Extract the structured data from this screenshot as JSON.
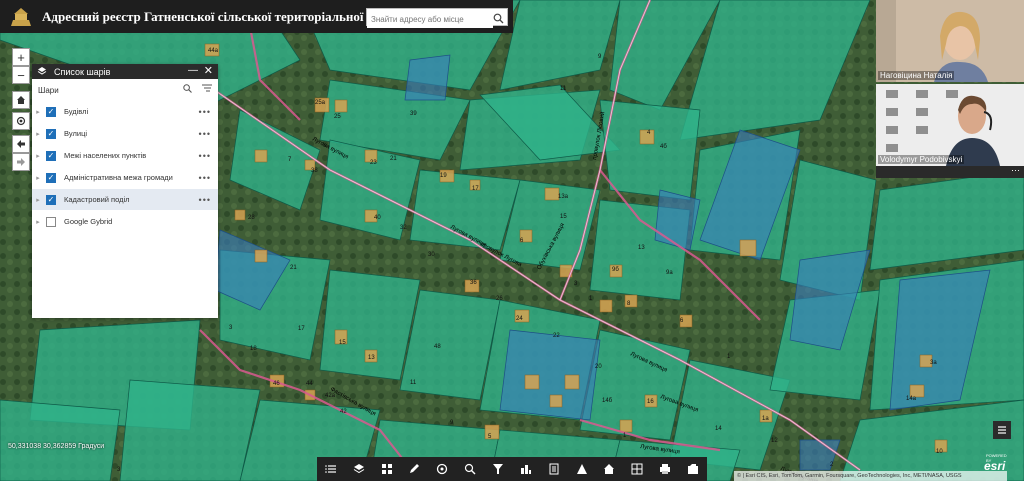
{
  "header": {
    "title": "Адресний реєстр Гатненської сільської територіальної громади",
    "search_placeholder": "Знайти адресу або місце"
  },
  "map_controls": {
    "zoom_in": "+",
    "zoom_out": "−"
  },
  "layer_panel": {
    "title": "Список шарів",
    "subheader": "Шари",
    "layers": [
      {
        "label": "Будівлі",
        "checked": true
      },
      {
        "label": "Вулиці",
        "checked": true
      },
      {
        "label": "Межі населених пунктів",
        "checked": true
      },
      {
        "label": "Адміністративна межа громади",
        "checked": true
      },
      {
        "label": "Кадастровий поділ",
        "checked": true
      },
      {
        "label": "Google Gybrid",
        "checked": false
      }
    ]
  },
  "coordinates": "50,331038 30,362859 Градуси",
  "map_labels": {
    "parcels": [
      "44a",
      "25a",
      "25",
      "9",
      "11",
      "39",
      "23",
      "21",
      "19",
      "17",
      "13a",
      "15",
      "4",
      "6",
      "13",
      "9a",
      "8",
      "7",
      "38",
      "36",
      "26",
      "24",
      "22",
      "20",
      "18",
      "46",
      "44",
      "42a",
      "42",
      "40",
      "32",
      "30",
      "28",
      "21",
      "17",
      "15",
      "13",
      "11",
      "9",
      "5",
      "3",
      "1",
      "1a",
      "3a",
      "14a",
      "14б",
      "16",
      "14",
      "12",
      "10",
      "2",
      "1",
      "3",
      "1",
      "3",
      "48",
      "9б",
      "4б",
      "6",
      "5"
    ],
    "streets": [
      "Лугова вулиця",
      "Лугова вулиця",
      "Лугова вулиця",
      "Лугова вулиця",
      "Лугова вулиця",
      "Лугова вулиця",
      "Обухівська вулиця",
      "провулок Лісовий",
      "провулок Лугова",
      "Фастівська вулиця"
    ]
  },
  "toolbar_icons": [
    "list-icon",
    "layers-icon",
    "grid-icon",
    "draw-icon",
    "print-icon",
    "filter-icon",
    "measure-icon",
    "funnel-icon",
    "doc-icon",
    "warning-icon",
    "home-icon",
    "select-icon",
    "printer-icon",
    "edit-icon"
  ],
  "attribution": "© | Esri CIS, Esri, TomTom, Garmin, Foursquare, GeoTechnologies, Inc, METI/NASA, USGS",
  "esri": {
    "brand": "esri",
    "powered_by": "POWERED BY"
  },
  "video": {
    "participants": [
      {
        "name": "Наговіцина Наталія"
      },
      {
        "name": "Volodymyr Podobivskyi"
      }
    ]
  }
}
